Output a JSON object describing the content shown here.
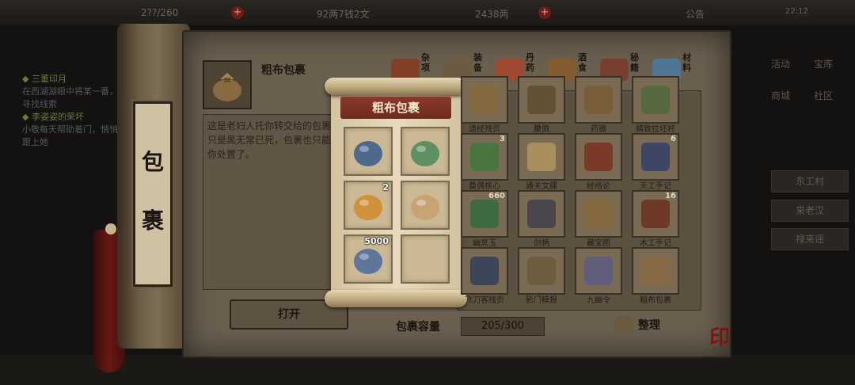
{
  "topbar": {
    "stamina": "2??/260",
    "coins": "92两7钱2文",
    "silver": "2438两",
    "notice": "公告",
    "time": "22:12"
  },
  "quests": [
    {
      "title": "三董印月",
      "desc": "在西湖湖眼中将某一番，寻找线索"
    },
    {
      "title": "李姿姿的荣坏",
      "desc": "小敬每天帮助着门，悄悄跟上她"
    }
  ],
  "right_menu": {
    "buttons": [
      "活动",
      "宝库",
      "商城",
      "社区"
    ],
    "bars": [
      "东工村",
      "来老汉",
      "禄来谣"
    ]
  },
  "scroll_label": [
    "包",
    "裹"
  ],
  "selected_item": {
    "name": "粗布包裹",
    "description": "这是老妇人托你转交给的包裹，只是黑无常已死，包裹也只能任你处置了。",
    "open_label": "打开"
  },
  "categories": [
    {
      "label": "杂项",
      "icon": "misc-icon",
      "color": "#8a3a22"
    },
    {
      "label": "装备",
      "icon": "equipment-icon",
      "color": "#6b5a40"
    },
    {
      "label": "丹药",
      "icon": "pill-icon",
      "color": "#a8452c"
    },
    {
      "label": "酒食",
      "icon": "food-icon",
      "color": "#8a5a2a"
    },
    {
      "label": "秘籍",
      "icon": "book-icon",
      "color": "#7a3a2a"
    },
    {
      "label": "材料",
      "icon": "material-icon",
      "color": "#4a7aa0"
    }
  ],
  "inventory": [
    {
      "name": "遗经残页",
      "count": "",
      "icon": "scroll-page-icon",
      "color": "#8a6a3a"
    },
    {
      "name": "腰佩",
      "count": "",
      "icon": "belt-icon",
      "color": "#5a4a2a"
    },
    {
      "name": "药锄",
      "count": "",
      "icon": "hoe-icon",
      "color": "#7a5a30"
    },
    {
      "name": "精致拉坯杆",
      "count": "",
      "icon": "rod-icon",
      "color": "#4a6a3a"
    },
    {
      "name": "奠偶核心",
      "count": "3",
      "icon": "core-icon",
      "color": "#3a7a3a"
    },
    {
      "name": "通关文牒",
      "count": "",
      "icon": "pass-icon",
      "color": "#b89a60"
    },
    {
      "name": "经络论",
      "count": "",
      "icon": "treatise-icon",
      "color": "#7a2a1a"
    },
    {
      "name": "天工手记",
      "count": "6",
      "icon": "notebook-icon",
      "color": "#2a3a6a"
    },
    {
      "name": "幽冥玉",
      "count": "660",
      "icon": "jade-icon",
      "color": "#2a6a3a"
    },
    {
      "name": "剑柄",
      "count": "",
      "icon": "hilt-icon",
      "color": "#3a3a4a"
    },
    {
      "name": "藏宝图",
      "count": "",
      "icon": "map-icon",
      "color": "#8a6a3a"
    },
    {
      "name": "木工手记",
      "count": "16",
      "icon": "woodwork-book-icon",
      "color": "#6a2a1a"
    },
    {
      "name": "飞刀客残页",
      "count": "",
      "icon": "blade-page-icon",
      "color": "#2a3a5a"
    },
    {
      "name": "影门模报",
      "count": "",
      "icon": "shadow-report-icon",
      "color": "#6a5a3a"
    },
    {
      "name": "九幽令",
      "count": "",
      "icon": "token-icon",
      "color": "#5a5a8a"
    },
    {
      "name": "粗布包裹",
      "count": "",
      "icon": "cloth-bundle-icon",
      "color": "#8a6a40"
    }
  ],
  "capacity": {
    "label": "包裹容量",
    "value": "205/300"
  },
  "sort_label": "整理",
  "popup": {
    "title": "粗布包裹",
    "items": [
      {
        "icon": "wine-bottle-icon",
        "count": "",
        "color": "#3a5a8a"
      },
      {
        "icon": "herb-jar-icon",
        "count": "",
        "color": "#4a8a5a"
      },
      {
        "icon": "fried-snack-icon",
        "count": "2",
        "color": "#d08a2a"
      },
      {
        "icon": "letter-icon",
        "count": "",
        "color": "#c8a070"
      },
      {
        "icon": "silver-ingot-icon",
        "count": "5000",
        "color": "#4a6a9a"
      },
      {
        "icon": "",
        "count": "",
        "color": ""
      }
    ]
  }
}
